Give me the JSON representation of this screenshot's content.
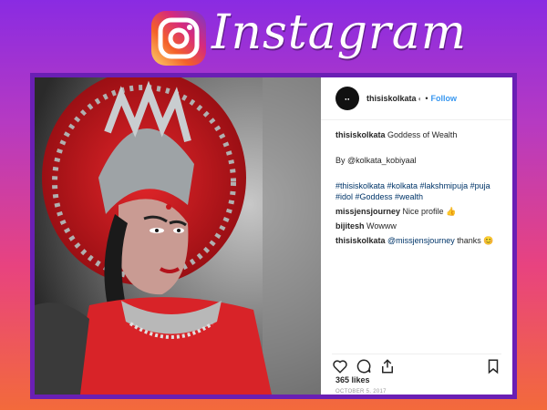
{
  "banner": {
    "wordmark": "Instagram",
    "icon": "instagram-logo-icon"
  },
  "post": {
    "username": "thisiskolkata",
    "verified_icon": "badge-icon",
    "follow_label": "Follow",
    "caption_text": "Goddess of Wealth",
    "credit": "By @kolkata_kobiyaal",
    "hashtags": "#thisiskolkata #kolkata #lakshmipuja #puja #idol #Goddess #wealth",
    "comments": [
      {
        "user": "missjensjourney",
        "text": "Nice profile",
        "emoji": "👍"
      },
      {
        "user": "bijitesh",
        "text": "Wowww"
      },
      {
        "user": "thisiskolkata",
        "mention": "@missjensjourney",
        "text": "thanks",
        "emoji": "😊"
      }
    ],
    "likes": "365 likes",
    "date": "OCTOBER 5, 2017"
  },
  "colors": {
    "link": "#3897f0",
    "accent": "#6a1fb4"
  }
}
